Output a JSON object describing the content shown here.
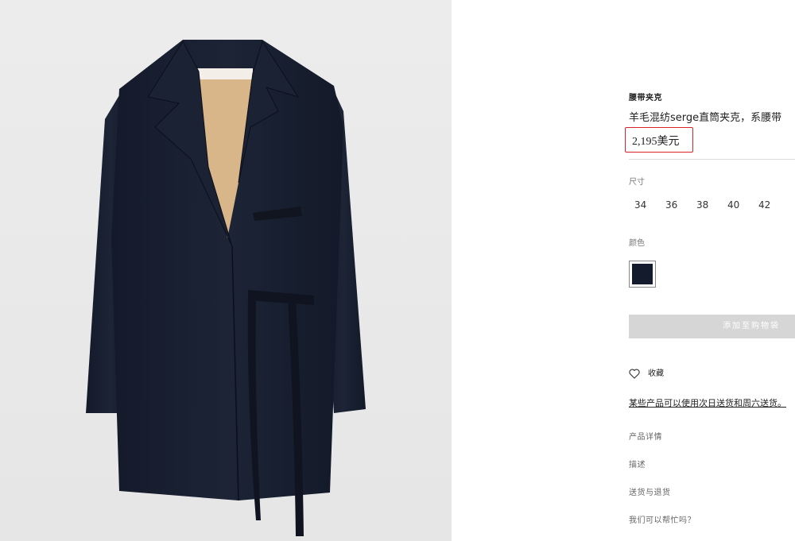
{
  "product": {
    "category": "腰带夹克",
    "name": "羊毛混纺serge直筒夹克，系腰带",
    "price": "2,195美元",
    "image_alt": "navy-wool-belted-jacket"
  },
  "size": {
    "label": "尺寸",
    "options": [
      "34",
      "36",
      "38",
      "40",
      "42"
    ]
  },
  "color": {
    "label": "颜色",
    "swatch_color": "#141b2c"
  },
  "actions": {
    "add_to_cart": "添加至购物袋",
    "wishlist": "收藏"
  },
  "delivery_note": "某些产品可以使用次日送货和周六送货。",
  "accordion": [
    "产品详情",
    "描述",
    "送货与退货",
    "我们可以帮忙吗？"
  ],
  "colors": {
    "price_highlight": "#d9232a",
    "button_disabled": "#d6d6d6",
    "jacket": "#161d2e"
  }
}
